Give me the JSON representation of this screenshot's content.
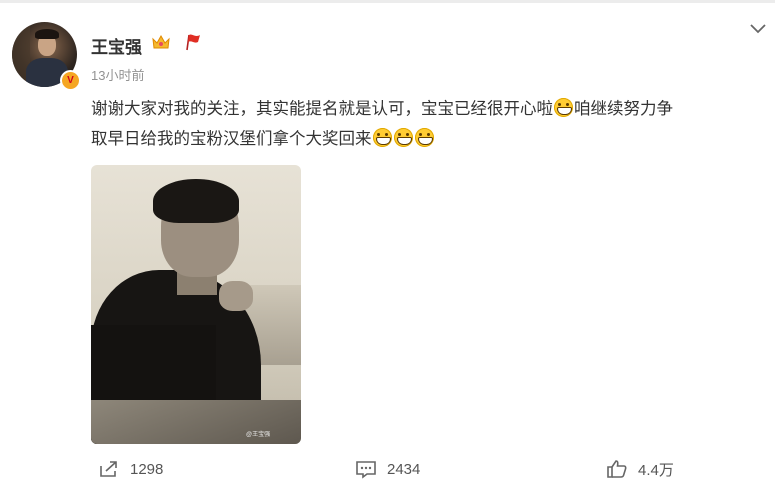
{
  "post": {
    "username": "王宝强",
    "timestamp": "13小时前",
    "text_line1_a": "谢谢大家对我的关注，其实能提名就是认可，宝宝已经很开心啦",
    "text_line1_b": "咱继续努力争",
    "text_line2": "取早日给我的宝粉汉堡们拿个大奖回来",
    "emoji_name": "grin-emoji",
    "photo_watermark": "@王宝强"
  },
  "actions": {
    "share_count": "1298",
    "comment_count": "2434",
    "like_count": "4.4万"
  },
  "icons": {
    "verified": "v-badge-icon",
    "crown": "crown-icon",
    "flag": "red-flag-icon",
    "more": "chevron-down-icon",
    "share": "share-icon",
    "comment": "comment-icon",
    "like": "thumbs-up-icon"
  },
  "colors": {
    "text": "#333333",
    "meta": "#939393",
    "verified_badge": "#f5a623",
    "flag": "#e02e24"
  }
}
